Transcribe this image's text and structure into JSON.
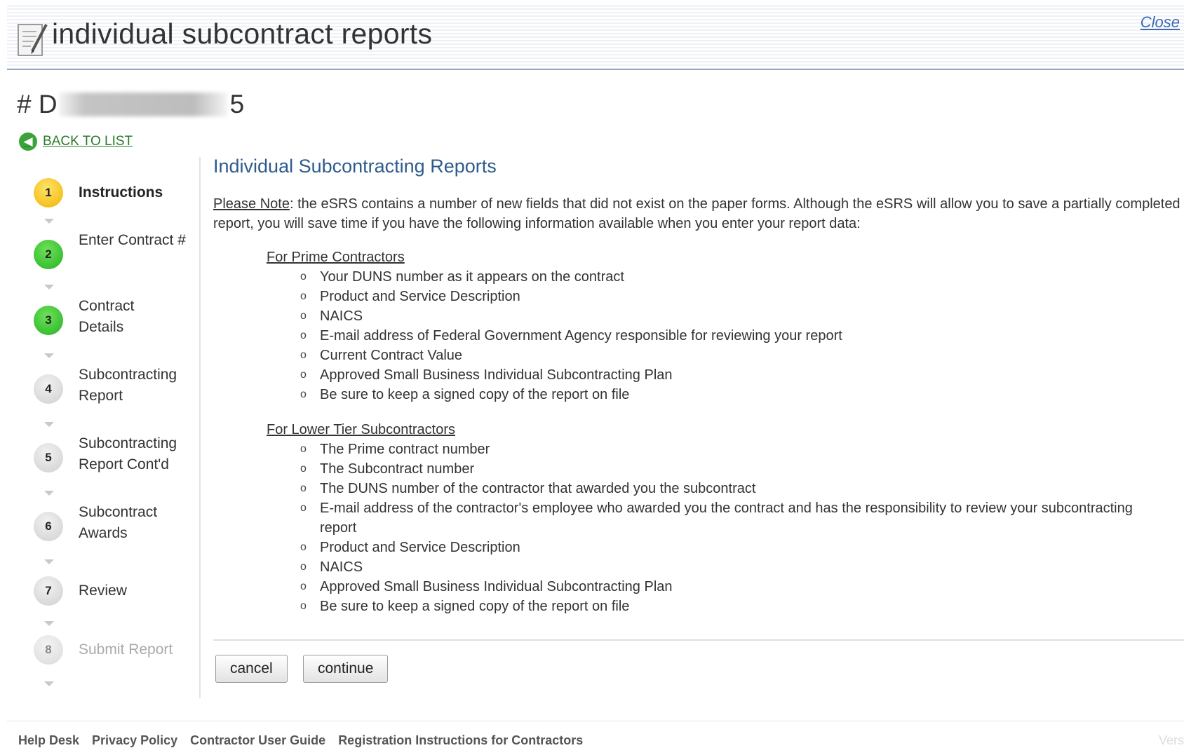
{
  "header": {
    "title": "individual subcontract reports",
    "close_label": "Close"
  },
  "contract": {
    "prefix": "# D",
    "suffix": "5"
  },
  "back_link": "BACK TO LIST",
  "steps": [
    {
      "number": "1",
      "label": "Instructions",
      "state": "current"
    },
    {
      "number": "2",
      "label": "Enter Contract #",
      "state": "done"
    },
    {
      "number": "3",
      "label": "Contract Details",
      "state": "done"
    },
    {
      "number": "4",
      "label": "Subcontracting Report",
      "state": "todo"
    },
    {
      "number": "5",
      "label": "Subcontracting Report Cont'd",
      "state": "todo"
    },
    {
      "number": "6",
      "label": "Subcontract Awards",
      "state": "todo"
    },
    {
      "number": "7",
      "label": "Review",
      "state": "todo"
    },
    {
      "number": "8",
      "label": "Submit Report",
      "state": "disabled"
    }
  ],
  "main": {
    "title": "Individual Subcontracting Reports",
    "note_label": "Please Note",
    "note_text": ": the eSRS contains a number of new fields that did not exist on the paper forms. Although the eSRS will allow you to save a partially completed report, you will save time if you have the following information available when you enter your report data:",
    "prime": {
      "heading": "For Prime Contractors",
      "items": [
        "Your DUNS number as it appears on the contract",
        "Product and Service Description",
        "NAICS",
        "E-mail address of Federal Government Agency responsible for reviewing your report",
        "Current Contract Value",
        "Approved Small Business Individual Subcontracting Plan",
        "Be sure to keep a signed copy of the report on file"
      ]
    },
    "lower": {
      "heading": "For Lower Tier Subcontractors",
      "items": [
        "The Prime contract number",
        "The Subcontract number",
        "The DUNS number of the contractor that awarded you the subcontract",
        "E-mail address of the contractor's employee who awarded you the contract and has the responsibility to review your subcontracting report",
        "Product and Service Description",
        "NAICS",
        "Approved Small Business Individual Subcontracting Plan",
        "Be sure to keep a signed copy of the report on file"
      ]
    },
    "bullet": "o"
  },
  "buttons": {
    "cancel": "cancel",
    "continue": "continue"
  },
  "footer": {
    "links": [
      "Help Desk",
      "Privacy Policy",
      "Contractor User Guide",
      "Registration Instructions for Contractors"
    ],
    "version_fragment": "Vers"
  },
  "colors": {
    "title_blue": "#2d5b8e",
    "link_green": "#2a7a2a",
    "close_blue": "#3c69b3"
  }
}
